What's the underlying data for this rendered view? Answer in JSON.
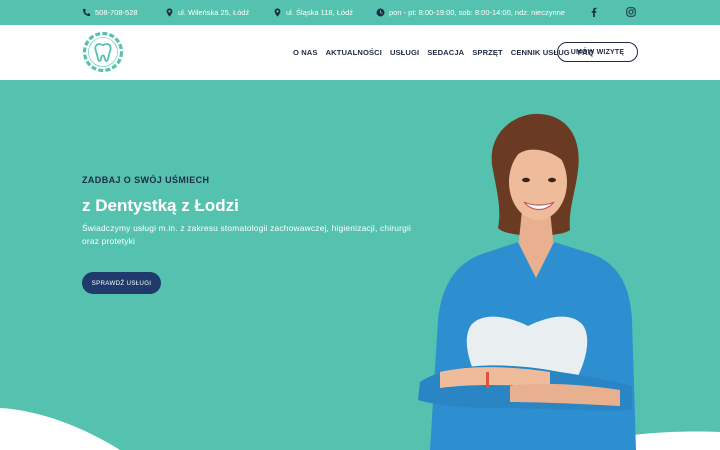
{
  "topbar": {
    "phone": "508-708-528",
    "address_1": "ul. Wileńska 25, Łódź",
    "address_2": "ul. Śląska 118, Łódź",
    "hours": "pon - pt: 8:00-19:00, sob: 8:00-14:00, ndz: nieczynne",
    "icons": [
      "phone-icon",
      "map-pin-icon",
      "map-pin-icon",
      "clock-icon",
      "facebook-icon",
      "instagram-icon"
    ]
  },
  "header": {
    "nav": [
      {
        "label": "O NAS"
      },
      {
        "label": "AKTUALNOŚCI"
      },
      {
        "label": "USŁUGI"
      },
      {
        "label": "SEDACJA"
      },
      {
        "label": "SPRZĘT"
      },
      {
        "label": "CENNIK USŁUG"
      },
      {
        "label": "FAQ"
      }
    ],
    "cta_label": "UMÓW WIZYTĘ"
  },
  "hero": {
    "eyebrow": "ZADBAJ O SWÓJ UŚMIECH",
    "title": "z Dentystką z Łodzi",
    "description": "Świadczymy usługi m.in. z zakresu stomatologii zachowawczej, higienizacji, chirurgii oraz protetyki",
    "button_label": "SPRAWDŹ USŁUGI"
  },
  "colors": {
    "teal": "#55c2af",
    "navy": "#1f2a44",
    "button_navy": "#1f3a6b",
    "white": "#ffffff"
  }
}
